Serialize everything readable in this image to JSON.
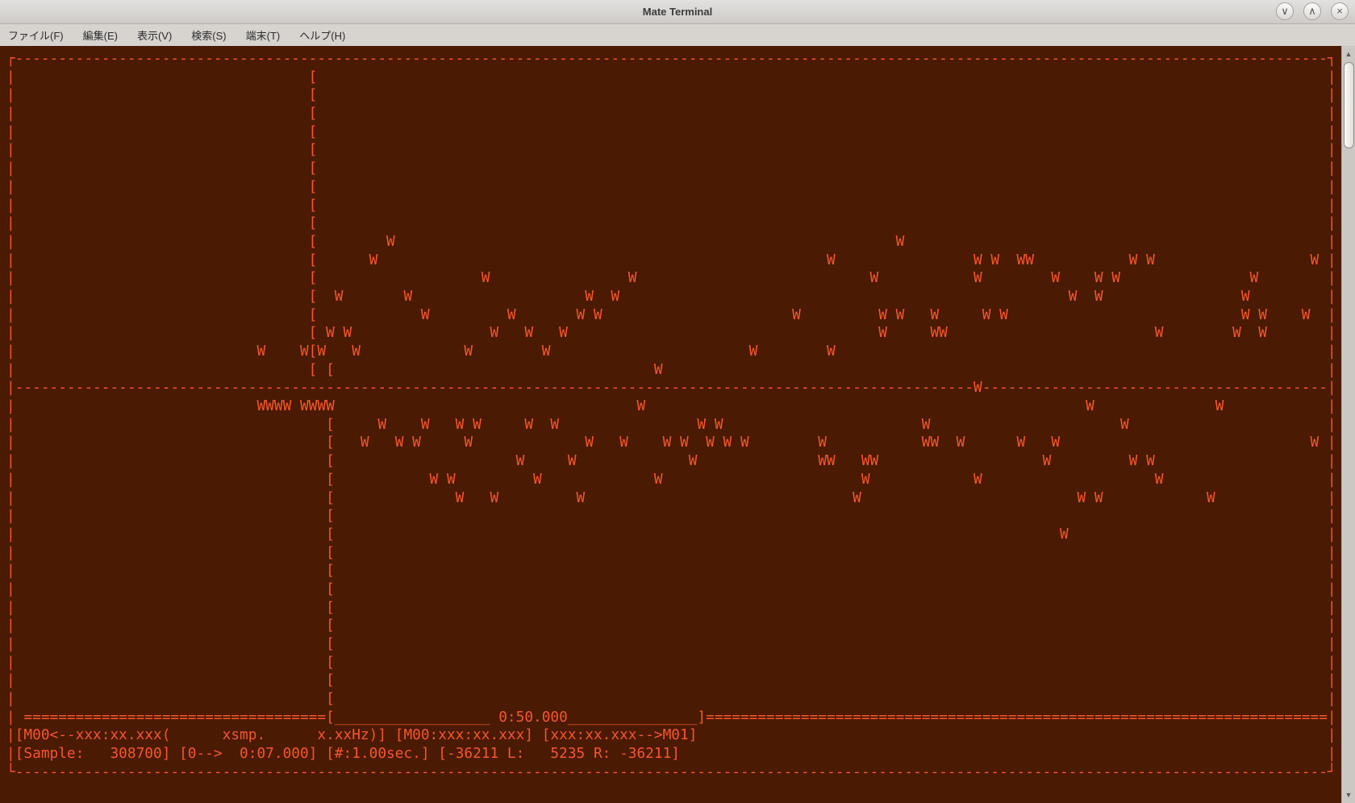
{
  "window": {
    "title": "Mate Terminal",
    "controls": [
      {
        "name": "minimize",
        "glyph": "∨"
      },
      {
        "name": "maximize",
        "glyph": "∧"
      },
      {
        "name": "close",
        "glyph": "×"
      }
    ]
  },
  "menu": {
    "items": [
      "ファイル(F)",
      "編集(E)",
      "表示(V)",
      "検索(S)",
      "端末(T)",
      "ヘルプ(H)"
    ]
  },
  "scrollbar": {
    "up_glyph": "▲",
    "down_glyph": "▼"
  },
  "terminal": {
    "colors": {
      "background": "#4a1a03",
      "foreground": "#f7562b"
    },
    "grid": {
      "rows": 40,
      "cols": 154
    },
    "readouts": {
      "marker_line": "[M00<--xxx:xx.xxx(      xsmp.      x.xxHz)] [M00:xxx:xx.xxx] [xxx:xx.xxx-->M01]",
      "sample_line": "[Sample:   308700] [0-->  0:07.000] [#:1.00sec.] [-36211 L:   5235 R: -36211]",
      "time_bar": "0:50.000"
    },
    "lines": [
      {
        "0": "┌",
        "1": [
          "-",
          152
        ],
        "153": "┐"
      },
      {
        "0": "|",
        "35": "[",
        "153": "|"
      },
      {
        "0": "|",
        "35": "[",
        "153": "|"
      },
      {
        "0": "|",
        "35": "[",
        "153": "|"
      },
      {
        "0": "|",
        "35": "[",
        "153": "|"
      },
      {
        "0": "|",
        "35": "[",
        "153": "|"
      },
      {
        "0": "|",
        "35": "[",
        "153": "|"
      },
      {
        "0": "|",
        "35": "[",
        "153": "|"
      },
      {
        "0": "|",
        "35": "[",
        "153": "|"
      },
      {
        "0": "|",
        "35": "[",
        "153": "|"
      },
      {
        "0": "|",
        "35": "[",
        "44": "W",
        "103": "W",
        "153": "|"
      },
      {
        "0": "|",
        "35": "[",
        "42": "W",
        "95": "W",
        "112": "W",
        "114": "W",
        "117": "WW",
        "130": "W",
        "132": "W",
        "151": "W",
        "153": "|"
      },
      {
        "0": "|",
        "35": "[",
        "55": "W",
        "72": "W",
        "100": "W",
        "112": "W",
        "121": "W",
        "126": "W",
        "128": "W",
        "144": "W",
        "153": "|"
      },
      {
        "0": "|",
        "35": "[",
        "38": "W",
        "46": "W",
        "67": "W",
        "70": "W",
        "123": "W",
        "126": "W",
        "143": "W",
        "153": "|"
      },
      {
        "0": "|",
        "35": "[",
        "48": "W",
        "58": "W",
        "66": "W",
        "68": "W",
        "91": "W",
        "101": "W",
        "103": "W",
        "107": "W",
        "113": "W",
        "115": "W",
        "143": "W",
        "145": "W",
        "150": "W",
        "153": "|"
      },
      {
        "0": "|",
        "35": "[",
        "37": "W",
        "39": "W",
        "56": "W",
        "60": "W",
        "64": "W",
        "101": "W",
        "107": "WW",
        "133": "W",
        "142": "W",
        "145": "W",
        "153": "|"
      },
      {
        "0": "|",
        "29": "W",
        "34": "W",
        "35": "[",
        "36": "W",
        "40": "W",
        "53": "W",
        "62": "W",
        "86": "W",
        "95": "W",
        "153": "|"
      },
      {
        "0": "|",
        "35": "[",
        "37": "[",
        "75": "W",
        "153": "|"
      },
      {
        "0": "|",
        "1": [
          "-",
          111
        ],
        "112": "W",
        "113": [
          "-",
          40
        ],
        "153": "|"
      },
      {
        "0": "|",
        "29": "WWWW",
        "34": "WWWW",
        "73": "W",
        "125": "W",
        "140": "W",
        "153": "|"
      },
      {
        "0": "|",
        "37": "[",
        "43": "W",
        "48": "W",
        "52": "W",
        "54": "W",
        "60": "W",
        "63": "W",
        "80": "W",
        "82": "W",
        "106": "W",
        "129": "W",
        "153": "|"
      },
      {
        "0": "|",
        "37": "[",
        "41": "W",
        "45": "W",
        "47": "W",
        "53": "W",
        "67": "W",
        "71": "W",
        "76": "W",
        "78": "W",
        "81": "W",
        "83": "W",
        "85": "W",
        "94": "W",
        "106": "WW",
        "110": "W",
        "117": "W",
        "121": "W",
        "151": "W",
        "153": "|"
      },
      {
        "0": "|",
        "37": "[",
        "59": "W",
        "65": "W",
        "79": "W",
        "94": "WW",
        "99": "WW",
        "120": "W",
        "130": "W",
        "132": "W",
        "153": "|"
      },
      {
        "0": "|",
        "37": "[",
        "49": "W",
        "51": "W",
        "61": "W",
        "75": "W",
        "99": "W",
        "112": "W",
        "133": "W",
        "153": "|"
      },
      {
        "0": "|",
        "37": "[",
        "52": "W",
        "56": "W",
        "66": "W",
        "98": "W",
        "124": "W",
        "126": "W",
        "139": "W",
        "153": "|"
      },
      {
        "0": "|",
        "37": "[",
        "153": "|"
      },
      {
        "0": "|",
        "37": "[",
        "122": "W",
        "153": "|"
      },
      {
        "0": "|",
        "37": "[",
        "153": "|"
      },
      {
        "0": "|",
        "37": "[",
        "153": "|"
      },
      {
        "0": "|",
        "37": "[",
        "153": "|"
      },
      {
        "0": "|",
        "37": "[",
        "153": "|"
      },
      {
        "0": "|",
        "37": "[",
        "153": "|"
      },
      {
        "0": "|",
        "37": "[",
        "153": "|"
      },
      {
        "0": "|",
        "37": "[",
        "153": "|"
      },
      {
        "0": "|",
        "37": "[",
        "153": "|"
      },
      {
        "0": "|",
        "37": "[",
        "153": "|"
      },
      {
        "0": "|",
        "2": [
          "=",
          35
        ],
        "37": "[",
        "38": [
          "_",
          18
        ],
        "57": "0:50.000",
        "65": [
          "_",
          15
        ],
        "80": "]",
        "81": [
          "=",
          72
        ],
        "153": "|"
      },
      {
        "0": "|",
        "1": "[M00<--xxx:xx.xxx(      xsmp.      x.xxHz)] [M00:xxx:xx.xxx] [xxx:xx.xxx-->M01]",
        "153": "|"
      },
      {
        "0": "|",
        "1": "[Sample:   308700] [0-->  0:07.000] [#:1.00sec.] [-36211 L:   5235 R: -36211]",
        "153": "|"
      },
      {
        "0": "└",
        "1": [
          "-",
          152
        ],
        "153": "┘"
      }
    ]
  }
}
